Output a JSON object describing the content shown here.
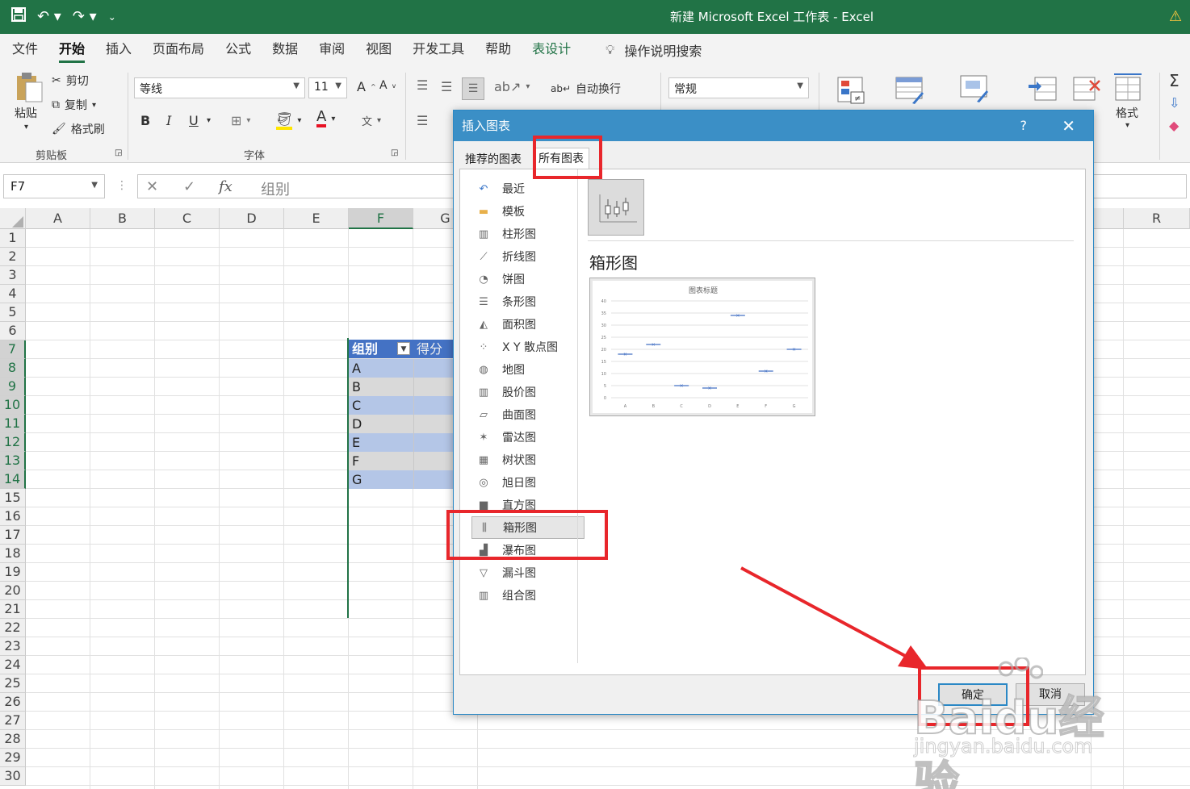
{
  "titlebar": {
    "title": "新建 Microsoft Excel 工作表  -  Excel"
  },
  "tabs": [
    {
      "label": "文件"
    },
    {
      "label": "开始"
    },
    {
      "label": "插入"
    },
    {
      "label": "页面布局"
    },
    {
      "label": "公式"
    },
    {
      "label": "数据"
    },
    {
      "label": "审阅"
    },
    {
      "label": "视图"
    },
    {
      "label": "开发工具"
    },
    {
      "label": "帮助"
    },
    {
      "label": "表设计"
    }
  ],
  "search_label": "操作说明搜索",
  "ribbon": {
    "paste": "粘贴",
    "cut": "剪切",
    "copy": "复制",
    "format_painter": "格式刷",
    "clipboard_group": "剪贴板",
    "font_name": "等线",
    "font_size": "11",
    "font_group": "字体",
    "wrap_text": "自动换行",
    "number_format": "常规",
    "format": "格式",
    "bold": "B",
    "italic": "I",
    "underline": "U"
  },
  "formula_bar": {
    "name_box": "F7",
    "value": "组别"
  },
  "columns": [
    "A",
    "B",
    "C",
    "D",
    "E",
    "F",
    "G",
    "R"
  ],
  "rows": [
    "1",
    "2",
    "3",
    "4",
    "5",
    "6",
    "7",
    "8",
    "9",
    "10",
    "11",
    "12",
    "13",
    "14",
    "15",
    "16",
    "17",
    "18",
    "19",
    "20",
    "21",
    "22",
    "23",
    "24",
    "25",
    "26",
    "27",
    "28",
    "29",
    "30"
  ],
  "table": {
    "header1": "组别",
    "header2": "得分",
    "groups": [
      "A",
      "B",
      "C",
      "D",
      "E",
      "F",
      "G"
    ]
  },
  "dialog": {
    "title": "插入图表",
    "help": "?",
    "tab_recommended": "推荐的图表",
    "tab_all": "所有图表",
    "chart_types": [
      {
        "label": "最近",
        "icon": "recent-icon"
      },
      {
        "label": "模板",
        "icon": "folder-icon"
      },
      {
        "label": "柱形图",
        "icon": "column-chart-icon"
      },
      {
        "label": "折线图",
        "icon": "line-chart-icon"
      },
      {
        "label": "饼图",
        "icon": "pie-chart-icon"
      },
      {
        "label": "条形图",
        "icon": "bar-chart-icon"
      },
      {
        "label": "面积图",
        "icon": "area-chart-icon"
      },
      {
        "label": "X Y 散点图",
        "icon": "scatter-chart-icon"
      },
      {
        "label": "地图",
        "icon": "map-chart-icon"
      },
      {
        "label": "股价图",
        "icon": "stock-chart-icon"
      },
      {
        "label": "曲面图",
        "icon": "surface-chart-icon"
      },
      {
        "label": "雷达图",
        "icon": "radar-chart-icon"
      },
      {
        "label": "树状图",
        "icon": "treemap-chart-icon"
      },
      {
        "label": "旭日图",
        "icon": "sunburst-chart-icon"
      },
      {
        "label": "直方图",
        "icon": "histogram-chart-icon"
      },
      {
        "label": "箱形图",
        "icon": "box-whisker-chart-icon"
      },
      {
        "label": "瀑布图",
        "icon": "waterfall-chart-icon"
      },
      {
        "label": "漏斗图",
        "icon": "funnel-chart-icon"
      },
      {
        "label": "组合图",
        "icon": "combo-chart-icon"
      }
    ],
    "selected_type": "箱形图",
    "chart_heading": "箱形图",
    "ok": "确定",
    "cancel": "取消"
  },
  "chart_data": {
    "type": "scatter",
    "title": "图表标题",
    "categories": [
      "A",
      "B",
      "C",
      "D",
      "E",
      "F",
      "G"
    ],
    "values": [
      18,
      22,
      5,
      4,
      34,
      11,
      20
    ],
    "ylim": [
      0,
      40
    ],
    "yticks": [
      0,
      5,
      10,
      15,
      20,
      25,
      30,
      35,
      40
    ],
    "grid": true
  },
  "watermark": {
    "brand": "Baidu经验",
    "url": "jingyan.baidu.com"
  },
  "colors": {
    "excel_green": "#217346",
    "dialog_blue": "#3b8fc6",
    "annotation_red": "#e8262b",
    "table_header": "#4472c4"
  }
}
